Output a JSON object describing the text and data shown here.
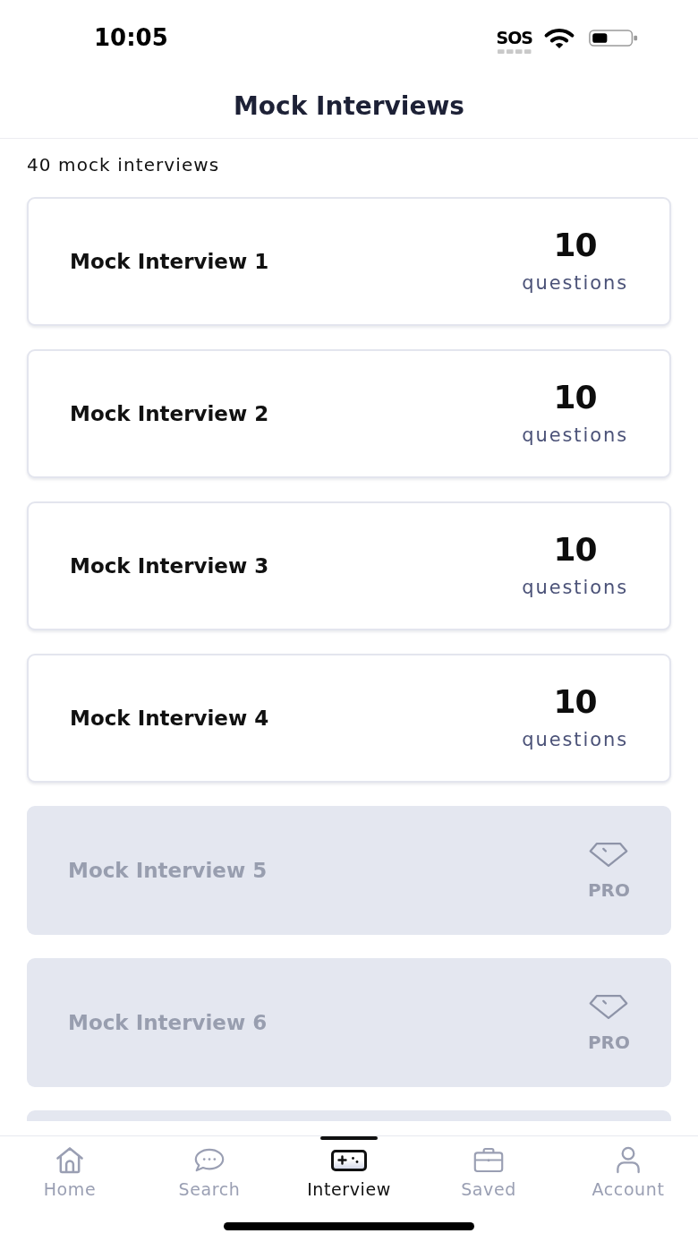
{
  "status_bar": {
    "time": "10:05",
    "sos": "SOS"
  },
  "header": {
    "title": "Mock Interviews"
  },
  "summary": "40 mock interviews",
  "interviews": [
    {
      "name": "Mock Interview 1",
      "locked": false,
      "count": "10",
      "unit": "questions"
    },
    {
      "name": "Mock Interview 2",
      "locked": false,
      "count": "10",
      "unit": "questions"
    },
    {
      "name": "Mock Interview 3",
      "locked": false,
      "count": "10",
      "unit": "questions"
    },
    {
      "name": "Mock Interview 4",
      "locked": false,
      "count": "10",
      "unit": "questions"
    },
    {
      "name": "Mock Interview 5",
      "locked": true,
      "badge": "PRO"
    },
    {
      "name": "Mock Interview 6",
      "locked": true,
      "badge": "PRO"
    },
    {
      "locked": true
    }
  ],
  "tabs": [
    {
      "label": "Home",
      "selected": false
    },
    {
      "label": "Search",
      "selected": false
    },
    {
      "label": "Interview",
      "selected": true
    },
    {
      "label": "Saved",
      "selected": false
    },
    {
      "label": "Account",
      "selected": false
    }
  ]
}
